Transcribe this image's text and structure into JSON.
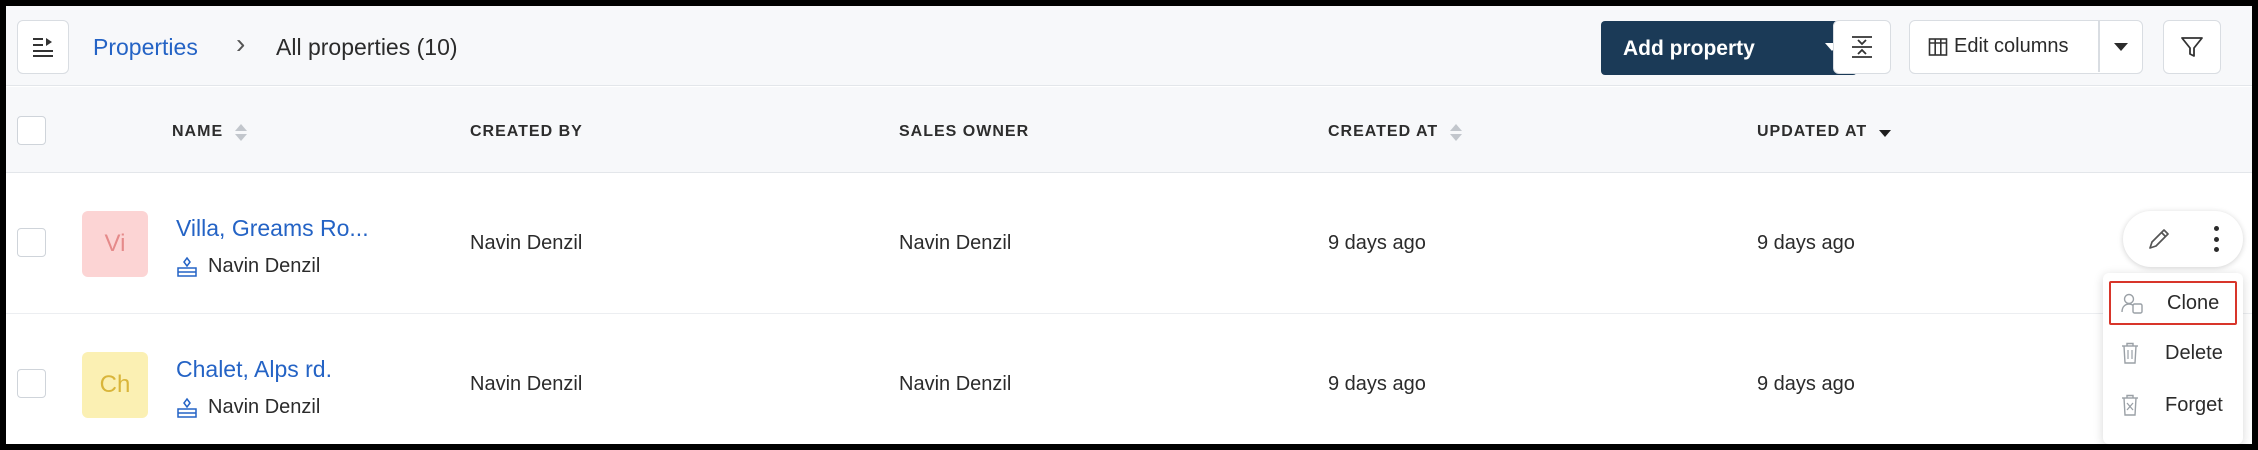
{
  "breadcrumb": {
    "parent": "Properties",
    "separator": "›",
    "current": "All properties (10)"
  },
  "toolbar": {
    "add_property_label": "Add property",
    "edit_columns_label": "Edit columns"
  },
  "table": {
    "columns": {
      "name": "NAME",
      "created_by": "CREATED BY",
      "sales_owner": "SALES OWNER",
      "created_at": "CREATED AT",
      "updated_at": "UPDATED AT"
    },
    "sort": {
      "column": "updated_at",
      "direction": "descending"
    },
    "rows": [
      {
        "avatar_initials": "Vi",
        "avatar_bg": "#fcd4d4",
        "avatar_fg": "#e58a8a",
        "name": "Villa, Greams Ro...",
        "owner": "Navin Denzil",
        "created_by": "Navin Denzil",
        "sales_owner": "Navin Denzil",
        "created_at": "9 days ago",
        "updated_at": "9 days ago"
      },
      {
        "avatar_initials": "Ch",
        "avatar_bg": "#fbf0b3",
        "avatar_fg": "#d9b53a",
        "name": "Chalet, Alps rd.",
        "owner": "Navin Denzil",
        "created_by": "Navin Denzil",
        "sales_owner": "Navin Denzil",
        "created_at": "9 days ago",
        "updated_at": "9 days ago"
      }
    ]
  },
  "action_menu": {
    "items": [
      "Clone",
      "Delete",
      "Forget"
    ],
    "highlighted": "Clone"
  },
  "colors": {
    "link": "#2463c5",
    "primary_button": "#1b3a57",
    "highlight_border": "#d8352a"
  }
}
